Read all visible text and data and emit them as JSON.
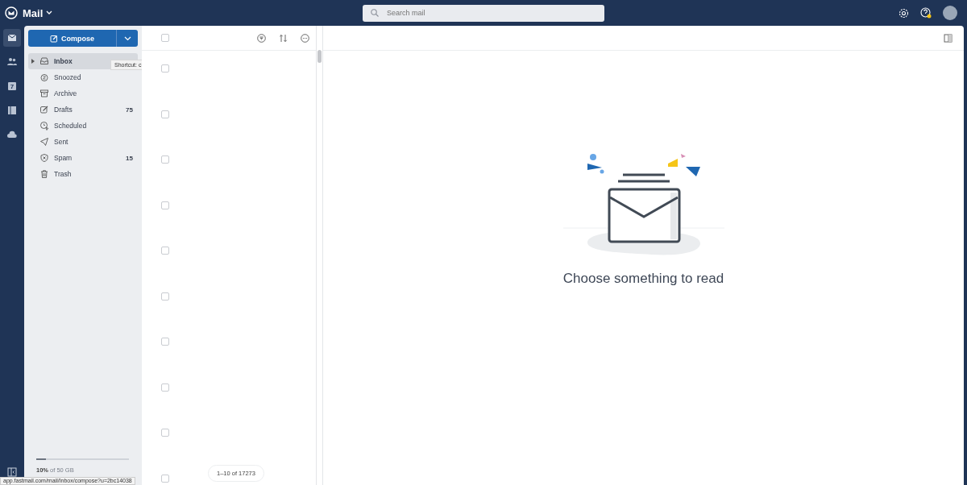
{
  "topbar": {
    "app_name": "Mail",
    "search": {
      "placeholder": "Search mail"
    }
  },
  "rail": [
    {
      "kind": "mail",
      "selected": true
    },
    {
      "kind": "contacts",
      "selected": false
    },
    {
      "kind": "calendar",
      "selected": false,
      "label": "7"
    },
    {
      "kind": "notes",
      "selected": false
    },
    {
      "kind": "files",
      "selected": false
    }
  ],
  "sidebar": {
    "compose": "Compose",
    "tooltip": "Shortcut: c",
    "folders": [
      {
        "kind": "inbox",
        "label": "Inbox",
        "selected": true
      },
      {
        "kind": "snoozed",
        "label": "Snoozed",
        "selected": false
      },
      {
        "kind": "archive",
        "label": "Archive",
        "selected": false
      },
      {
        "kind": "drafts",
        "label": "Drafts",
        "selected": false,
        "count": "75"
      },
      {
        "kind": "scheduled",
        "label": "Scheduled",
        "selected": false
      },
      {
        "kind": "sent",
        "label": "Sent",
        "selected": false
      },
      {
        "kind": "spam",
        "label": "Spam",
        "selected": false,
        "count": "15"
      },
      {
        "kind": "trash",
        "label": "Trash",
        "selected": false
      }
    ],
    "storage": {
      "text": "**10%** of 50 GB",
      "level": 0.1
    }
  },
  "message_list": {
    "select_all": {
      "checked": false
    },
    "rows": [
      {
        "checked": false
      },
      {
        "checked": false
      },
      {
        "checked": false
      },
      {
        "checked": false
      },
      {
        "checked": false
      },
      {
        "checked": false
      },
      {
        "checked": false
      },
      {
        "checked": false
      },
      {
        "checked": false
      },
      {
        "checked": false
      }
    ],
    "pagination": "1–10 of 17273"
  },
  "reading_pane": {
    "empty_text": "Choose something to read"
  },
  "status_url": "app.fastmail.com/mail/Inbox/compose?u=2bc14038"
}
